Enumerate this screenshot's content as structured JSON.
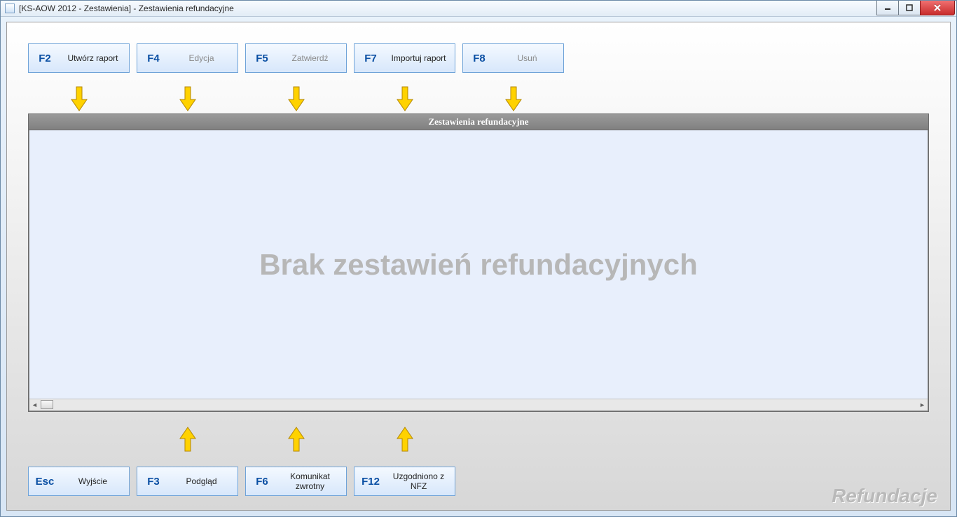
{
  "window": {
    "title": "[KS-AOW 2012 - Zestawienia] - Zestawienia refundacyjne"
  },
  "top_buttons": [
    {
      "key": "F2",
      "label": "Utwórz raport",
      "enabled": true
    },
    {
      "key": "F4",
      "label": "Edycja",
      "enabled": false
    },
    {
      "key": "F5",
      "label": "Zatwierdź",
      "enabled": false
    },
    {
      "key": "F7",
      "label": "Importuj raport",
      "enabled": true
    },
    {
      "key": "F8",
      "label": "Usuń",
      "enabled": false
    }
  ],
  "bottom_buttons": [
    {
      "key": "Esc",
      "label": "Wyjście",
      "enabled": true
    },
    {
      "key": "F3",
      "label": "Podgląd",
      "enabled": true
    },
    {
      "key": "F6",
      "label": "Komunikat zwrotny",
      "enabled": true
    },
    {
      "key": "F12",
      "label": "Uzgodniono z NFZ",
      "enabled": true
    }
  ],
  "grid": {
    "header": "Zestawienia refundacyjne",
    "empty_message": "Brak zestawień refundacyjnych"
  },
  "watermark": "Refundacje"
}
